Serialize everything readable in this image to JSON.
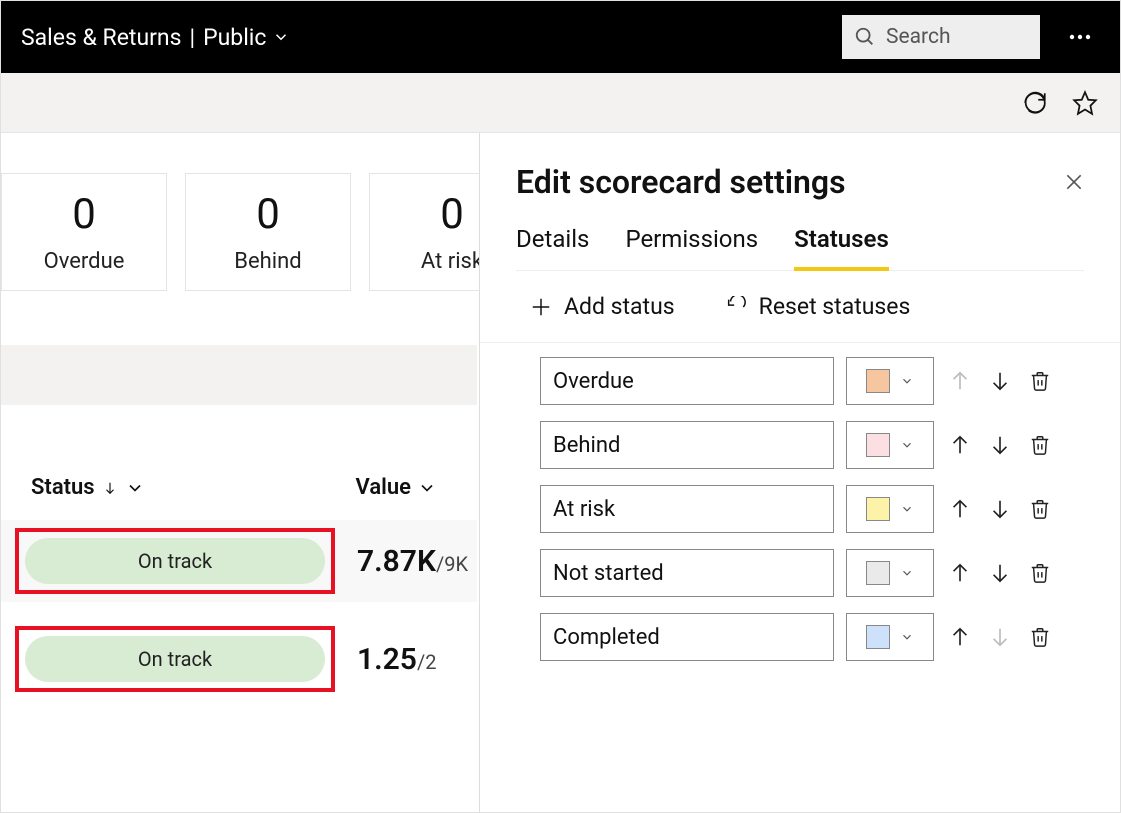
{
  "topbar": {
    "title": "Sales & Returns",
    "visibility": "Public",
    "search_placeholder": "Search"
  },
  "cards": [
    {
      "value": "0",
      "label": "Overdue"
    },
    {
      "value": "0",
      "label": "Behind"
    },
    {
      "value": "0",
      "label": "At risk"
    }
  ],
  "columns": {
    "status": "Status",
    "value": "Value"
  },
  "rows": [
    {
      "status": "On track",
      "value": "7.87K",
      "target": "/9K"
    },
    {
      "status": "On track",
      "value": "1.25",
      "target": "/2"
    }
  ],
  "panel": {
    "title": "Edit scorecard settings",
    "tabs": {
      "details": "Details",
      "permissions": "Permissions",
      "statuses": "Statuses"
    },
    "actions": {
      "add": "Add status",
      "reset": "Reset statuses"
    },
    "statuses": [
      {
        "name": "Overdue",
        "color": "#f6c6a0",
        "up_disabled": true,
        "down_disabled": false
      },
      {
        "name": "Behind",
        "color": "#fcdfe2",
        "up_disabled": false,
        "down_disabled": false
      },
      {
        "name": "At risk",
        "color": "#fcf2a8",
        "up_disabled": false,
        "down_disabled": false
      },
      {
        "name": "Not started",
        "color": "#eaeaea",
        "up_disabled": false,
        "down_disabled": false
      },
      {
        "name": "Completed",
        "color": "#cde1fb",
        "up_disabled": false,
        "down_disabled": true
      }
    ]
  },
  "colors": {
    "highlight": "#e81123",
    "pill": "#d8ecd4"
  }
}
